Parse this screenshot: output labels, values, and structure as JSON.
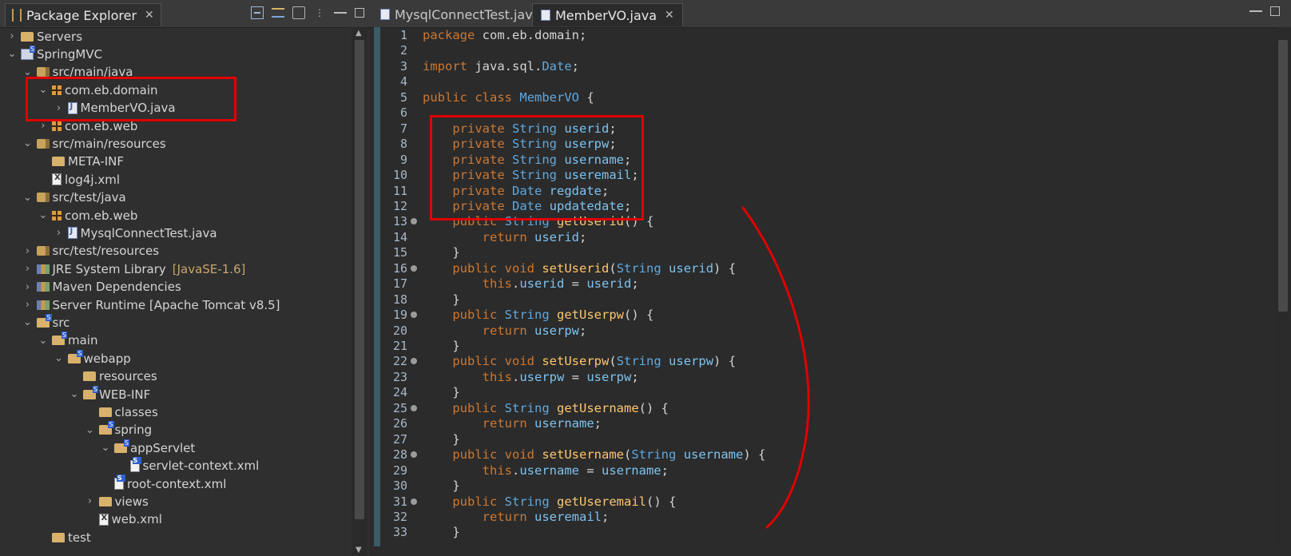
{
  "explorer": {
    "title": "Package Explorer",
    "tree": [
      {
        "label": "Servers",
        "icon": "folder-icon",
        "twisty": ">"
      },
      {
        "label": "SpringMVC",
        "icon": "project-icon",
        "twisty": "v"
      },
      {
        "label": "src/main/java",
        "icon": "source-folder-icon",
        "twisty": "v"
      },
      {
        "label": "com.eb.domain",
        "icon": "package-icon",
        "twisty": "v"
      },
      {
        "label": "MemberVO.java",
        "icon": "java-file-icon",
        "twisty": ">"
      },
      {
        "label": "com.eb.web",
        "icon": "package-icon",
        "twisty": ">"
      },
      {
        "label": "src/main/resources",
        "icon": "source-folder-icon",
        "twisty": "v"
      },
      {
        "label": "META-INF",
        "icon": "folder-icon",
        "twisty": ""
      },
      {
        "label": "log4j.xml",
        "icon": "xml-file-icon",
        "twisty": ""
      },
      {
        "label": "src/test/java",
        "icon": "source-folder-icon",
        "twisty": "v"
      },
      {
        "label": "com.eb.web",
        "icon": "package-icon",
        "twisty": "v"
      },
      {
        "label": "MysqlConnectTest.java",
        "icon": "java-file-icon",
        "twisty": ">"
      },
      {
        "label": "src/test/resources",
        "icon": "source-folder-icon",
        "twisty": ">"
      },
      {
        "label": "JRE System Library",
        "tag": "[JavaSE-1.6]",
        "icon": "library-icon",
        "twisty": ">"
      },
      {
        "label": "Maven Dependencies",
        "icon": "library-icon",
        "twisty": ">"
      },
      {
        "label": "Server Runtime [Apache Tomcat v8.5]",
        "icon": "library-icon",
        "twisty": ">"
      },
      {
        "label": "src",
        "icon": "folder-icon",
        "twisty": "v"
      },
      {
        "label": "main",
        "icon": "folder-icon",
        "twisty": "v"
      },
      {
        "label": "webapp",
        "icon": "folder-icon",
        "twisty": "v"
      },
      {
        "label": "resources",
        "icon": "folder-icon",
        "twisty": ""
      },
      {
        "label": "WEB-INF",
        "icon": "folder-icon",
        "twisty": "v"
      },
      {
        "label": "classes",
        "icon": "folder-icon",
        "twisty": ""
      },
      {
        "label": "spring",
        "icon": "folder-icon",
        "twisty": "v"
      },
      {
        "label": "appServlet",
        "icon": "folder-icon",
        "twisty": "v"
      },
      {
        "label": "servlet-context.xml",
        "icon": "xml-file-icon",
        "twisty": ""
      },
      {
        "label": "root-context.xml",
        "icon": "xml-file-icon",
        "twisty": ""
      },
      {
        "label": "views",
        "icon": "folder-icon",
        "twisty": ">"
      },
      {
        "label": "web.xml",
        "icon": "xml-file-icon",
        "twisty": ""
      },
      {
        "label": "test",
        "icon": "folder-icon",
        "twisty": ""
      }
    ]
  },
  "editor": {
    "tabs": [
      {
        "label": "MysqlConnectTest.java",
        "active": false
      },
      {
        "label": "MemberVO.java",
        "active": true
      }
    ],
    "lines": [
      {
        "n": "1",
        "code": "package com.eb.domain;"
      },
      {
        "n": "2",
        "code": ""
      },
      {
        "n": "3",
        "code": "import java.sql.Date;"
      },
      {
        "n": "4",
        "code": ""
      },
      {
        "n": "5",
        "code": "public class MemberVO {"
      },
      {
        "n": "6",
        "code": ""
      },
      {
        "n": "7",
        "code": "    private String userid;"
      },
      {
        "n": "8",
        "code": "    private String userpw;"
      },
      {
        "n": "9",
        "code": "    private String username;"
      },
      {
        "n": "10",
        "code": "    private String useremail;"
      },
      {
        "n": "11",
        "code": "    private Date regdate;"
      },
      {
        "n": "12",
        "code": "    private Date updatedate;"
      },
      {
        "n": "13",
        "code": "    public String getUserid() {"
      },
      {
        "n": "14",
        "code": "        return userid;"
      },
      {
        "n": "15",
        "code": "    }"
      },
      {
        "n": "16",
        "code": "    public void setUserid(String userid) {"
      },
      {
        "n": "17",
        "code": "        this.userid = userid;"
      },
      {
        "n": "18",
        "code": "    }"
      },
      {
        "n": "19",
        "code": "    public String getUserpw() {"
      },
      {
        "n": "20",
        "code": "        return userpw;"
      },
      {
        "n": "21",
        "code": "    }"
      },
      {
        "n": "22",
        "code": "    public void setUserpw(String userpw) {"
      },
      {
        "n": "23",
        "code": "        this.userpw = userpw;"
      },
      {
        "n": "24",
        "code": "    }"
      },
      {
        "n": "25",
        "code": "    public String getUsername() {"
      },
      {
        "n": "26",
        "code": "        return username;"
      },
      {
        "n": "27",
        "code": "    }"
      },
      {
        "n": "28",
        "code": "    public void setUsername(String username) {"
      },
      {
        "n": "29",
        "code": "        this.username = username;"
      },
      {
        "n": "30",
        "code": "    }"
      },
      {
        "n": "31",
        "code": "    public String getUseremail() {"
      },
      {
        "n": "32",
        "code": "        return useremail;"
      },
      {
        "n": "33",
        "code": "    }"
      }
    ]
  },
  "colors": {
    "keyword": "#cc7832",
    "type": "#5fa8e0",
    "method": "#ffc66d",
    "field": "#7dc3f0",
    "annotation": "#e00000"
  }
}
